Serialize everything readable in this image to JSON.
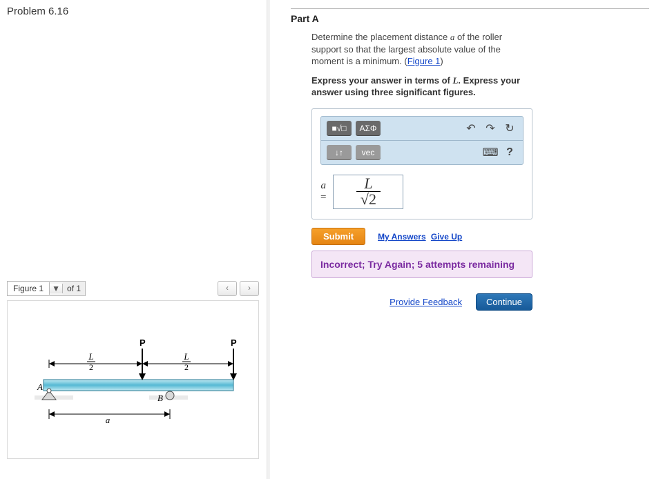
{
  "problem_title": "Problem 6.16",
  "figure": {
    "label": "Figure",
    "current": "1",
    "of_label": "of 1",
    "labels": {
      "P1": "P",
      "P2": "P",
      "Lhalf1": "L",
      "two1": "2",
      "Lhalf2": "L",
      "two2": "2",
      "A": "A",
      "B": "B",
      "a": "a"
    }
  },
  "part": {
    "title": "Part A",
    "question_pre": "Determine the placement distance ",
    "question_var": "a",
    "question_mid": " of the roller support so that the largest absolute value of the moment is a minimum. (",
    "figure_link": "Figure 1",
    "question_post": ")",
    "instruction_pre": "Express your answer in terms of ",
    "instruction_var": "L",
    "instruction_post": ". Express your answer using three significant figures."
  },
  "toolbar": {
    "templates_label": "■√□",
    "greek_label": "ΑΣΦ",
    "subsup_label": "↓↑",
    "vec_label": "vec",
    "keyboard_tip": "keyboard",
    "help_label": "?"
  },
  "answer": {
    "var": "a",
    "eq": "=",
    "value_num": "L",
    "value_den": "√2"
  },
  "actions": {
    "submit": "Submit",
    "my_answers": "My Answers",
    "give_up": "Give Up",
    "provide_feedback": "Provide Feedback",
    "continue": "Continue"
  },
  "feedback": "Incorrect; Try Again; 5 attempts remaining"
}
